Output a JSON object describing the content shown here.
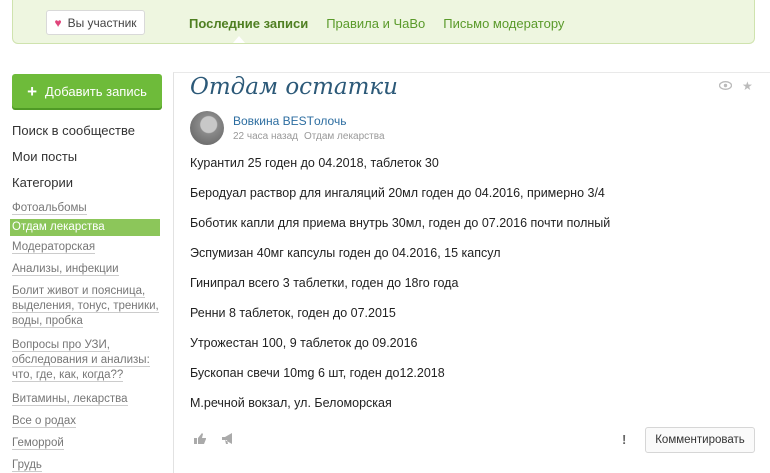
{
  "header": {
    "member_button": "Вы участник",
    "tabs": [
      {
        "label": "Последние записи",
        "active": true
      },
      {
        "label": "Правила и ЧаВо",
        "active": false
      },
      {
        "label": "Письмо модератору",
        "active": false
      }
    ]
  },
  "sidebar": {
    "add_button": "Добавить запись",
    "links": [
      "Поиск в сообществе",
      "Мои посты",
      "Категории"
    ],
    "categories": [
      "Фотоальбомы",
      "Отдам лекарства",
      "Модераторская",
      "Анализы, инфекции",
      "Болит живот и поясница, выделения, тонус, треники, воды, пробка",
      "Вопросы про УЗИ, обследования и анализы: что, где, как, когда??",
      "Витамины, лекарства",
      "Все о родах",
      "Геморрой",
      "Грудь"
    ],
    "active_category": "Отдам лекарства"
  },
  "post": {
    "title": "Отдам остатки",
    "author": "Вовкина BESTолочь",
    "time": "22 часа назад",
    "category": "Отдам лекарства",
    "lines": [
      "Курантил 25 годен до 04.2018, таблеток 30",
      "Беродуал раствор для ингаляций 20мл годен до 04.2016, примерно 3/4",
      "Боботик капли для приема внутрь 30мл, годен до 07.2016 почти полный",
      "Эспумизан 40мг капсулы годен до 04.2016, 15 капсул",
      "Гинипрал всего 3 таблетки, годен до 18го года",
      "Ренни 8 таблеток, годен до 07.2015",
      "Утрожестан 100, 9 таблеток до 09.2016",
      "Бускопан свечи 10mg 6 шт, годен до12.2018",
      "М.речной вокзал, ул. Беломорская"
    ],
    "exclamation": "!",
    "comment_button": "Комментировать"
  },
  "icons": {
    "heart": "heart-icon",
    "plus": "plus-icon",
    "eye": "eye-icon",
    "star": "star-icon",
    "like": "thumbs-up-icon",
    "share": "megaphone-icon"
  },
  "colors": {
    "accent_green": "#6ebb3a",
    "nav_green": "#5a9a2a",
    "title_blue": "#2c5978",
    "link_blue": "#2c6da0",
    "active_category_bg": "#8cc65a"
  }
}
